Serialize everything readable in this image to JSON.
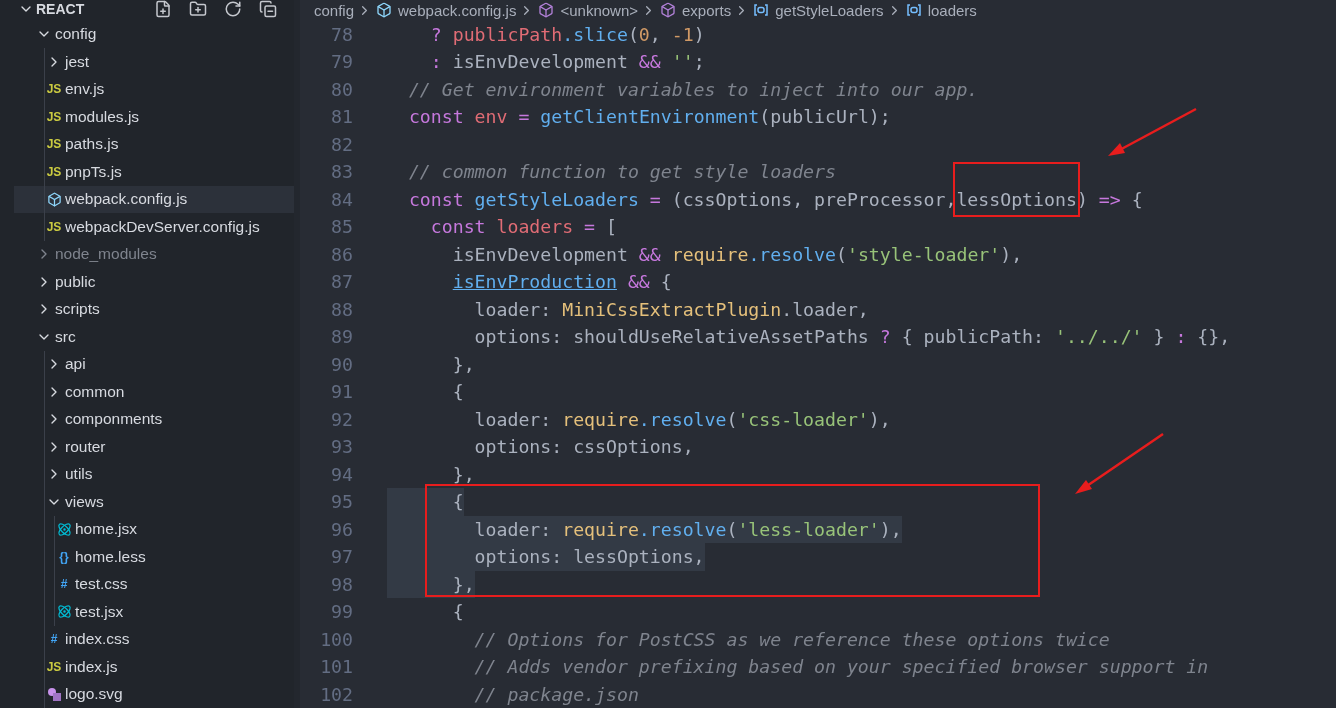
{
  "explorer": {
    "title": "REACT",
    "expanded": true,
    "tree": [
      {
        "label": "config",
        "kind": "folder",
        "expanded": true,
        "selected": false,
        "ignored": false,
        "children": [
          {
            "label": "jest",
            "kind": "folder",
            "expanded": false,
            "selected": false,
            "ignored": false
          },
          {
            "label": "env.js",
            "kind": "js",
            "glyph": "JS",
            "selected": false,
            "ignored": false
          },
          {
            "label": "modules.js",
            "kind": "js",
            "glyph": "JS",
            "selected": false,
            "ignored": false
          },
          {
            "label": "paths.js",
            "kind": "js",
            "glyph": "JS",
            "selected": false,
            "ignored": false
          },
          {
            "label": "pnpTs.js",
            "kind": "js",
            "glyph": "JS",
            "selected": false,
            "ignored": false
          },
          {
            "label": "webpack.config.js",
            "kind": "webpack",
            "selected": true,
            "ignored": false
          },
          {
            "label": "webpackDevServer.config.js",
            "kind": "js",
            "glyph": "JS",
            "selected": false,
            "ignored": false
          }
        ]
      },
      {
        "label": "node_modules",
        "kind": "folder",
        "expanded": false,
        "selected": false,
        "ignored": true
      },
      {
        "label": "public",
        "kind": "folder",
        "expanded": false,
        "selected": false,
        "ignored": false
      },
      {
        "label": "scripts",
        "kind": "folder",
        "expanded": false,
        "selected": false,
        "ignored": false
      },
      {
        "label": "src",
        "kind": "folder",
        "expanded": true,
        "selected": false,
        "ignored": false,
        "children": [
          {
            "label": "api",
            "kind": "folder",
            "expanded": false,
            "selected": false,
            "ignored": false
          },
          {
            "label": "common",
            "kind": "folder",
            "expanded": false,
            "selected": false,
            "ignored": false
          },
          {
            "label": "componments",
            "kind": "folder",
            "expanded": false,
            "selected": false,
            "ignored": false
          },
          {
            "label": "router",
            "kind": "folder",
            "expanded": false,
            "selected": false,
            "ignored": false
          },
          {
            "label": "utils",
            "kind": "folder",
            "expanded": false,
            "selected": false,
            "ignored": false
          },
          {
            "label": "views",
            "kind": "folder",
            "expanded": true,
            "selected": false,
            "ignored": false,
            "children": [
              {
                "label": "home.jsx",
                "kind": "react",
                "selected": false,
                "ignored": false
              },
              {
                "label": "home.less",
                "kind": "less",
                "glyph": "{}",
                "selected": false,
                "ignored": false
              },
              {
                "label": "test.css",
                "kind": "css",
                "glyph": "#",
                "selected": false,
                "ignored": false
              },
              {
                "label": "test.jsx",
                "kind": "react",
                "selected": false,
                "ignored": false
              }
            ]
          },
          {
            "label": "index.css",
            "kind": "css",
            "glyph": "#",
            "selected": false,
            "ignored": false
          },
          {
            "label": "index.js",
            "kind": "js",
            "glyph": "JS",
            "selected": false,
            "ignored": false
          },
          {
            "label": "logo.svg",
            "kind": "svg",
            "selected": false,
            "ignored": false
          }
        ]
      }
    ]
  },
  "breadcrumbs": [
    {
      "label": "config",
      "kind": "folder"
    },
    {
      "label": "webpack.config.js",
      "kind": "webpack"
    },
    {
      "label": "<unknown>",
      "kind": "module"
    },
    {
      "label": "exports",
      "kind": "module"
    },
    {
      "label": "getStyleLoaders",
      "kind": "variable"
    },
    {
      "label": "loaders",
      "kind": "variable"
    }
  ],
  "editor": {
    "lines": [
      {
        "number": "78",
        "selected": false,
        "boxed": false,
        "tokens": [
          {
            "text": "    ? ",
            "kind": "k"
          },
          {
            "text": "publicPath",
            "kind": "v"
          },
          {
            "text": ".slice",
            "kind": "f"
          },
          {
            "text": "(",
            "kind": "p"
          },
          {
            "text": "0",
            "kind": "n"
          },
          {
            "text": ", ",
            "kind": "p"
          },
          {
            "text": "-1",
            "kind": "n"
          },
          {
            "text": ")",
            "kind": "p"
          }
        ]
      },
      {
        "number": "79",
        "selected": false,
        "boxed": false,
        "tokens": [
          {
            "text": "    : ",
            "kind": "k"
          },
          {
            "text": "isEnvDevelopment ",
            "kind": "p"
          },
          {
            "text": "&& ",
            "kind": "k"
          },
          {
            "text": "''",
            "kind": "s"
          },
          {
            "text": ";",
            "kind": "p"
          }
        ]
      },
      {
        "number": "80",
        "selected": false,
        "boxed": false,
        "tokens": [
          {
            "text": "  // Get environment variables to inject into our app.",
            "kind": "m"
          }
        ]
      },
      {
        "number": "81",
        "selected": false,
        "boxed": false,
        "tokens": [
          {
            "text": "  const ",
            "kind": "k"
          },
          {
            "text": "env",
            "kind": "v"
          },
          {
            "text": " = ",
            "kind": "k"
          },
          {
            "text": "getClientEnvironment",
            "kind": "f"
          },
          {
            "text": "(publicUrl);",
            "kind": "p"
          }
        ]
      },
      {
        "number": "82",
        "selected": false,
        "boxed": false
      },
      {
        "number": "83",
        "selected": false,
        "boxed": false,
        "tokens": [
          {
            "text": "  // common function to get style loaders",
            "kind": "m"
          }
        ]
      },
      {
        "number": "84",
        "selected": false,
        "boxed": false,
        "tokens": [
          {
            "text": "  const ",
            "kind": "k"
          },
          {
            "text": "getStyleLoaders",
            "kind": "f"
          },
          {
            "text": " = ",
            "kind": "k"
          },
          {
            "text": "(cssOptions, preProcessor,",
            "kind": "p"
          },
          {
            "text": "lessOptions",
            "kind": "p",
            "boxed": true
          },
          {
            "text": ") ",
            "kind": "p"
          },
          {
            "text": "=>",
            "kind": "k"
          },
          {
            "text": " {",
            "kind": "p"
          }
        ]
      },
      {
        "number": "85",
        "selected": false,
        "boxed": false,
        "tokens": [
          {
            "text": "    const ",
            "kind": "k"
          },
          {
            "text": "loaders",
            "kind": "v"
          },
          {
            "text": " = ",
            "kind": "k"
          },
          {
            "text": "[",
            "kind": "p"
          }
        ]
      },
      {
        "number": "86",
        "selected": false,
        "boxed": false,
        "tokens": [
          {
            "text": "      isEnvDevelopment ",
            "kind": "p"
          },
          {
            "text": "&& ",
            "kind": "k"
          },
          {
            "text": "require",
            "kind": "c"
          },
          {
            "text": ".resolve",
            "kind": "f"
          },
          {
            "text": "(",
            "kind": "p"
          },
          {
            "text": "'style-loader'",
            "kind": "s"
          },
          {
            "text": "),",
            "kind": "p"
          }
        ]
      },
      {
        "number": "87",
        "selected": false,
        "boxed": false,
        "tokens": [
          {
            "text": "      isEnvProduction",
            "kind": "u"
          },
          {
            "text": " &&",
            "kind": "k"
          },
          {
            "text": " {",
            "kind": "p"
          }
        ]
      },
      {
        "number": "88",
        "selected": false,
        "boxed": false,
        "tokens": [
          {
            "text": "        loader: ",
            "kind": "p"
          },
          {
            "text": "MiniCssExtractPlugin",
            "kind": "c"
          },
          {
            "text": ".loader,",
            "kind": "p"
          }
        ]
      },
      {
        "number": "89",
        "selected": false,
        "boxed": false,
        "tokens": [
          {
            "text": "        options: shouldUseRelativeAssetPaths ",
            "kind": "p"
          },
          {
            "text": "?",
            "kind": "k"
          },
          {
            "text": " { publicPath: ",
            "kind": "p"
          },
          {
            "text": "'../../'",
            "kind": "s"
          },
          {
            "text": " } ",
            "kind": "p"
          },
          {
            "text": ":",
            "kind": "k"
          },
          {
            "text": " {},",
            "kind": "p"
          }
        ]
      },
      {
        "number": "90",
        "selected": false,
        "boxed": false,
        "tokens": [
          {
            "text": "      },",
            "kind": "p"
          }
        ]
      },
      {
        "number": "91",
        "selected": false,
        "boxed": false,
        "tokens": [
          {
            "text": "      {",
            "kind": "p"
          }
        ]
      },
      {
        "number": "92",
        "selected": false,
        "boxed": false,
        "tokens": [
          {
            "text": "        loader: ",
            "kind": "p"
          },
          {
            "text": "require",
            "kind": "c"
          },
          {
            "text": ".resolve",
            "kind": "f"
          },
          {
            "text": "(",
            "kind": "p"
          },
          {
            "text": "'css-loader'",
            "kind": "s"
          },
          {
            "text": "),",
            "kind": "p"
          }
        ]
      },
      {
        "number": "93",
        "selected": false,
        "boxed": false,
        "tokens": [
          {
            "text": "        options: cssOptions,",
            "kind": "p"
          }
        ]
      },
      {
        "number": "94",
        "selected": false,
        "boxed": false,
        "tokens": [
          {
            "text": "      },",
            "kind": "p"
          }
        ]
      },
      {
        "number": "95",
        "selected": true,
        "boxed": true,
        "tokens": [
          {
            "text": "      {",
            "kind": "p"
          }
        ]
      },
      {
        "number": "96",
        "selected": true,
        "boxed": true,
        "tokens": [
          {
            "text": "        loader: ",
            "kind": "p"
          },
          {
            "text": "require",
            "kind": "c"
          },
          {
            "text": ".resolve",
            "kind": "f"
          },
          {
            "text": "(",
            "kind": "p"
          },
          {
            "text": "'less-loader'",
            "kind": "s"
          },
          {
            "text": "),",
            "kind": "p"
          }
        ]
      },
      {
        "number": "97",
        "selected": true,
        "boxed": true,
        "tokens": [
          {
            "text": "        options: lessOptions,",
            "kind": "p"
          }
        ]
      },
      {
        "number": "98",
        "selected": true,
        "boxed": true,
        "tokens": [
          {
            "text": "      },",
            "kind": "p"
          }
        ]
      },
      {
        "number": "99",
        "selected": false,
        "boxed": false,
        "tokens": [
          {
            "text": "      {",
            "kind": "p"
          }
        ]
      },
      {
        "number": "100",
        "selected": false,
        "boxed": false,
        "tokens": [
          {
            "text": "        // Options for PostCSS as we reference these options twice",
            "kind": "m"
          }
        ]
      },
      {
        "number": "101",
        "selected": false,
        "boxed": false,
        "tokens": [
          {
            "text": "        // Adds vendor prefixing based on your specified browser support in",
            "kind": "m"
          }
        ]
      },
      {
        "number": "102",
        "selected": false,
        "boxed": false,
        "tokens": [
          {
            "text": "        // package.json",
            "kind": "m"
          }
        ]
      }
    ]
  }
}
